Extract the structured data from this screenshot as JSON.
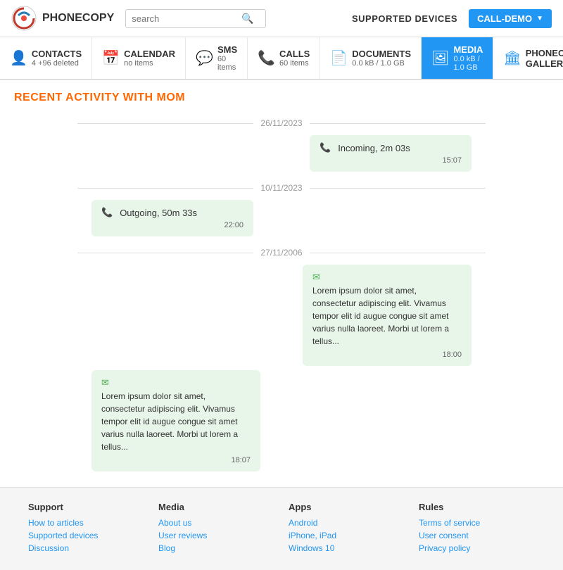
{
  "header": {
    "logo_text": "PHONECOPY",
    "search_placeholder": "search",
    "supported_devices_label": "SUPPORTED DEVICES",
    "call_demo_label": "CALL-DEMO"
  },
  "nav": {
    "tabs": [
      {
        "id": "contacts",
        "icon": "👤",
        "label": "CONTACTS",
        "sub": "4 +96 deleted",
        "active": false
      },
      {
        "id": "calendar",
        "icon": "📅",
        "label": "CALENDAR",
        "sub": "no items",
        "active": false
      },
      {
        "id": "sms",
        "icon": "💬",
        "label": "SMS",
        "sub": "60 items",
        "active": false
      },
      {
        "id": "calls",
        "icon": "📞",
        "label": "CALLS",
        "sub": "60 items",
        "active": false
      },
      {
        "id": "documents",
        "icon": "📄",
        "label": "DOCUMENTS",
        "sub": "0.0 kB / 1.0 GB",
        "active": false
      },
      {
        "id": "media",
        "icon": "🖼",
        "label": "MEDIA",
        "sub": "0.0 kB / 1.0 GB",
        "active": true
      },
      {
        "id": "phonecopy",
        "icon": "🏛",
        "label": "PHONECOPY GALLERY",
        "sub": "",
        "active": false,
        "new": true
      }
    ]
  },
  "main": {
    "page_title": "RECENT ACTIVITY WITH MOM",
    "activities": [
      {
        "date": "26/11/2023",
        "messages": [
          {
            "type": "call-incoming",
            "text": "Incoming, 2m 03s",
            "time": "15:07",
            "align": "right"
          }
        ]
      },
      {
        "date": "10/11/2023",
        "messages": [
          {
            "type": "call-outgoing",
            "text": "Outgoing, 50m 33s",
            "time": "22:00",
            "align": "left"
          }
        ]
      },
      {
        "date": "27/11/2006",
        "messages": [
          {
            "type": "sms-in",
            "text": "Lorem ipsum dolor sit amet, consectetur adipiscing elit. Vivamus tempor elit id augue congue sit amet varius nulla laoreet. Morbi ut lorem a tellus...",
            "time": "18:00",
            "align": "right"
          },
          {
            "type": "sms-out",
            "text": "Lorem ipsum dolor sit amet, consectetur adipiscing elit. Vivamus tempor elit id augue congue sit amet varius nulla laoreet. Morbi ut lorem a tellus...",
            "time": "18:07",
            "align": "left"
          }
        ]
      }
    ]
  },
  "footer": {
    "columns": [
      {
        "heading": "Support",
        "links": [
          "How to articles",
          "Supported devices",
          "Discussion"
        ]
      },
      {
        "heading": "Media",
        "links": [
          "About us",
          "User reviews",
          "Blog"
        ]
      },
      {
        "heading": "Apps",
        "links": [
          "Android",
          "iPhone, iPad",
          "Windows 10"
        ]
      },
      {
        "heading": "Rules",
        "links": [
          "Terms of service",
          "User consent",
          "Privacy policy"
        ]
      }
    ]
  }
}
